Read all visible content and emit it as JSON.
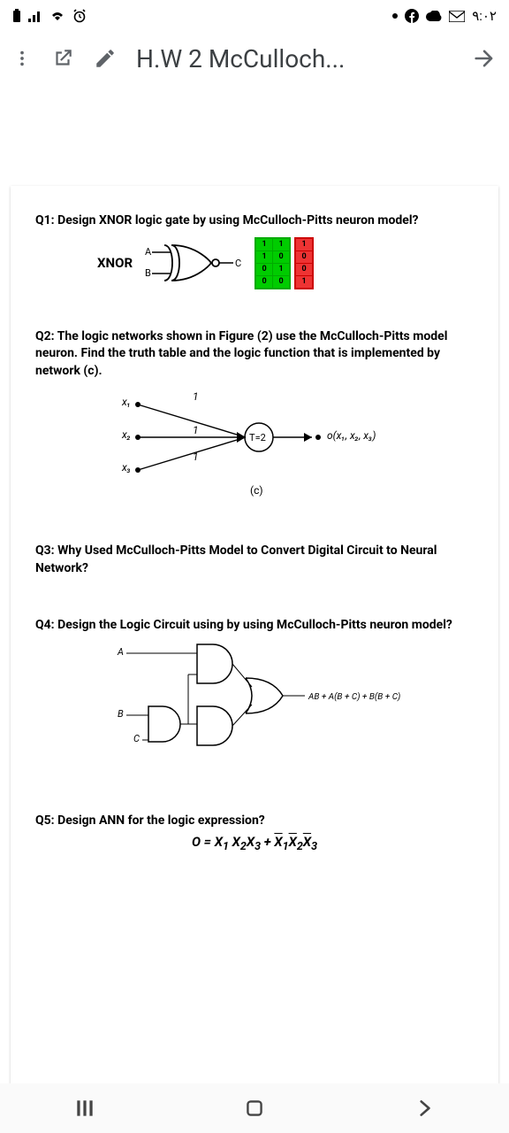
{
  "status": {
    "time": "٩:٠٢"
  },
  "header": {
    "title": "H.W 2 McCulloch..."
  },
  "doc": {
    "q1": {
      "text": "Q1: Design XNOR logic gate by using McCulloch-Pitts neuron model?",
      "gate_label": "XNOR",
      "input_a": "A",
      "input_b": "B",
      "output": "C",
      "truth_in": [
        [
          "1",
          "1"
        ],
        [
          "1",
          "0"
        ],
        [
          "0",
          "1"
        ],
        [
          "0",
          "0"
        ]
      ],
      "truth_out": [
        "1",
        "0",
        "0",
        "1"
      ]
    },
    "q2": {
      "text": "Q2: The logic networks shown in Figure (2) use the McCulloch-Pitts model neuron. Find the truth table and the logic function that is implemented by network (c).",
      "x1": "x₁",
      "x2": "x₂",
      "x3": "x₃",
      "w": "1",
      "node": "T=2",
      "out": "o(x₁, x₂, x₃)",
      "cap": "(c)"
    },
    "q3": "Q3: Why Used McCulloch-Pitts Model to Convert Digital Circuit to Neural Network?",
    "q4": {
      "text": "Q4: Design the Logic Circuit using by using McCulloch-Pitts neuron model?",
      "a": "A",
      "b": "B",
      "c": "C",
      "out": "AB + A(B + C) + B(B + C)"
    },
    "q5": {
      "text": "Q5: Design ANN for the logic expression?",
      "expr_plain": "O = X₁ X₂X₃ + X̄₁X̄₂X̄₃"
    }
  }
}
